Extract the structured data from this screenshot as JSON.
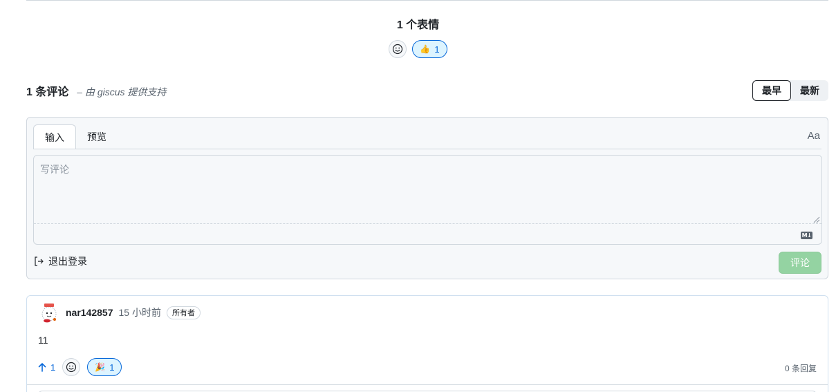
{
  "reactions": {
    "title": "1 个表情",
    "items": [
      {
        "emoji": "👍",
        "count": "1"
      }
    ]
  },
  "comments_header": {
    "count_label": "1 条评论",
    "powered_by": "– 由 giscus 提供支持",
    "sort": {
      "oldest": "最早",
      "newest": "最新",
      "active": "oldest"
    }
  },
  "editor": {
    "tab_write": "输入",
    "tab_preview": "预览",
    "format_toggle": "Aa",
    "placeholder": "写评论",
    "sign_out": "退出登录",
    "submit": "评论"
  },
  "comment": {
    "author": "nar142857",
    "time": "15 小时前",
    "badge": "所有者",
    "body": "11",
    "upvotes": "1",
    "reaction": {
      "emoji": "🎉",
      "count": "1"
    },
    "replies": "0 条回复"
  },
  "colors": {
    "accent": "#0969da",
    "accent_bg": "#ddf4ff",
    "submit_disabled": "#94d3a2",
    "border": "#d0d7de"
  }
}
